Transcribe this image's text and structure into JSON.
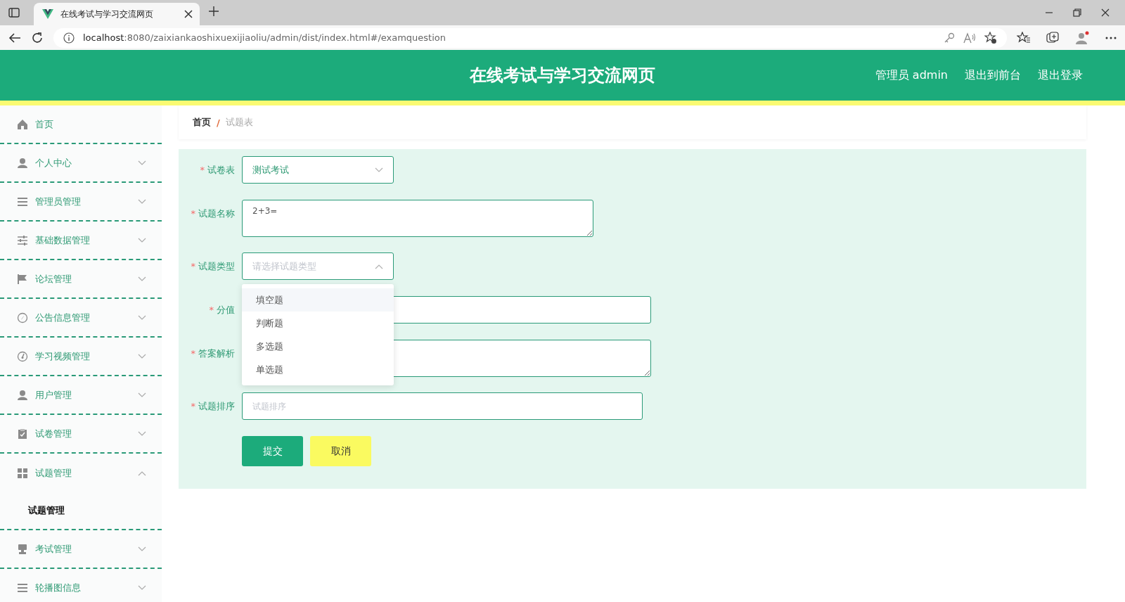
{
  "browser": {
    "tab_title": "在线考试与学习交流网页",
    "url_host": "localhost",
    "url_rest": ":8080/zaixiankaoshixuexijiaoliu/admin/dist/index.html#/examquestion"
  },
  "header": {
    "title": "在线考试与学习交流网页",
    "links": [
      "管理员 admin",
      "退出到前台",
      "退出登录"
    ]
  },
  "sidebar": {
    "items": [
      {
        "label": "首页",
        "kind": "link",
        "selected": false
      },
      {
        "label": "个人中心",
        "kind": "menu",
        "expanded": false
      },
      {
        "label": "管理员管理",
        "kind": "menu",
        "expanded": false
      },
      {
        "label": "基础数据管理",
        "kind": "menu",
        "expanded": false
      },
      {
        "label": "论坛管理",
        "kind": "menu",
        "expanded": false
      },
      {
        "label": "公告信息管理",
        "kind": "menu",
        "expanded": false
      },
      {
        "label": "学习视频管理",
        "kind": "menu",
        "expanded": false
      },
      {
        "label": "用户管理",
        "kind": "menu",
        "expanded": false
      },
      {
        "label": "试卷管理",
        "kind": "menu",
        "expanded": false
      },
      {
        "label": "试题管理",
        "kind": "menu",
        "expanded": true,
        "children": [
          {
            "label": "试题管理",
            "selected": true
          }
        ]
      },
      {
        "label": "考试管理",
        "kind": "menu",
        "expanded": false
      },
      {
        "label": "轮播图信息",
        "kind": "menu",
        "expanded": false
      }
    ]
  },
  "breadcrumb": {
    "items": [
      "首页",
      "试题表"
    ],
    "separator": "/"
  },
  "form": {
    "fields": [
      {
        "kind": "select",
        "marker": "*",
        "label": "试卷表",
        "value": "测试考试",
        "expanded": false
      },
      {
        "kind": "textarea",
        "marker": "*",
        "label": "试题名称",
        "value": "2+3="
      },
      {
        "kind": "select",
        "marker": "*",
        "label": "试题类型",
        "placeholder": "请选择试题类型",
        "expanded": true,
        "options": [
          {
            "label": "填空题",
            "highlighted": true
          },
          {
            "label": "判断题",
            "highlighted": false
          },
          {
            "label": "多选题",
            "highlighted": false
          },
          {
            "label": "单选题",
            "highlighted": false
          }
        ]
      },
      {
        "kind": "input",
        "marker": "*",
        "label": "分值"
      },
      {
        "kind": "textarea",
        "marker": "*",
        "label": "答案解析"
      },
      {
        "kind": "input",
        "marker": "*",
        "label": "试题排序",
        "placeholder": "试题排序"
      }
    ],
    "buttons": [
      {
        "label": "提交",
        "kind": "primary"
      },
      {
        "label": "取消",
        "kind": "secondary"
      }
    ]
  }
}
